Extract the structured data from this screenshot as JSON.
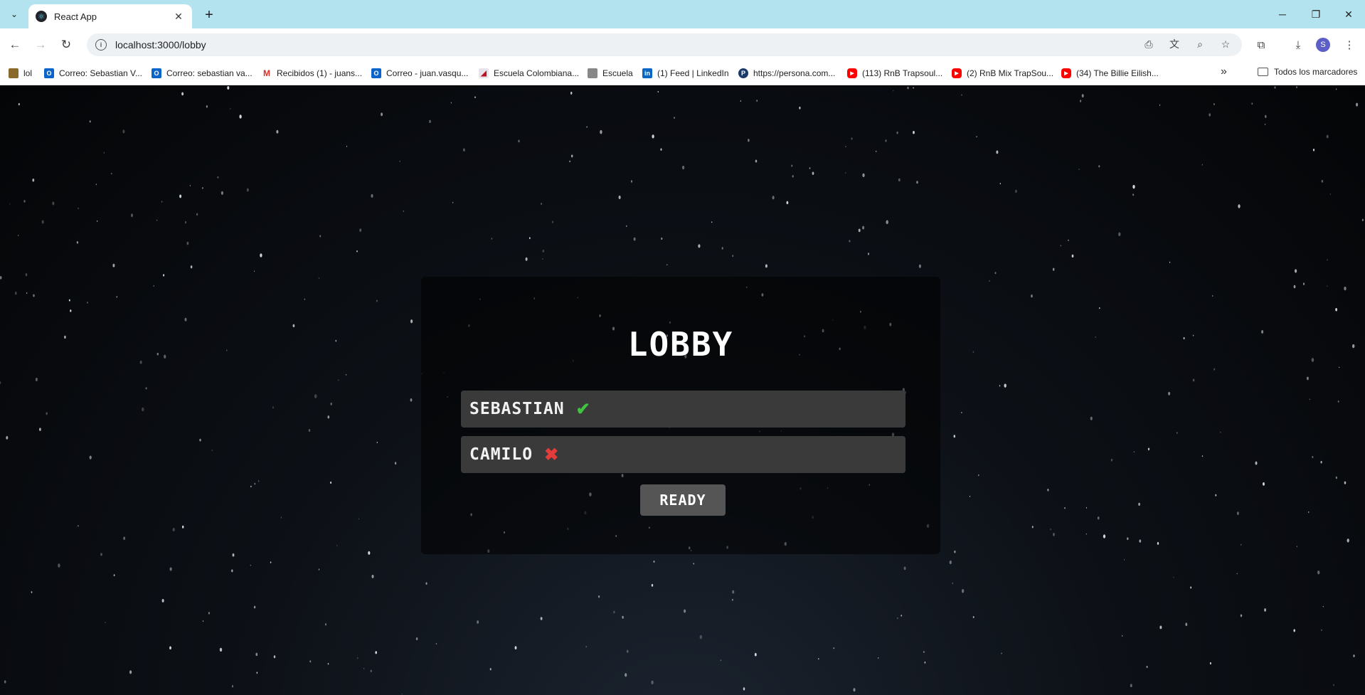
{
  "browser": {
    "tab": {
      "title": "React App",
      "favicon": "react-icon"
    },
    "url": "localhost:3000/lobby",
    "profile_initial": "S",
    "bookmarks": [
      {
        "label": "lol",
        "icon": "lol-icon"
      },
      {
        "label": "Correo: Sebastian V...",
        "icon": "outlook-icon"
      },
      {
        "label": "Correo: sebastian va...",
        "icon": "outlook-icon"
      },
      {
        "label": "Recibidos (1) - juans...",
        "icon": "gmail-icon"
      },
      {
        "label": "Correo - juan.vasqu...",
        "icon": "outlook-icon"
      },
      {
        "label": "Escuela Colombiana...",
        "icon": "escuela-icon"
      },
      {
        "label": "Escuela",
        "icon": "escuela-icon"
      },
      {
        "label": "(1) Feed | LinkedIn",
        "icon": "linkedin-icon"
      },
      {
        "label": "https://persona.com...",
        "icon": "persona-icon"
      },
      {
        "label": "(113) RnB Trapsoul...",
        "icon": "youtube-icon"
      },
      {
        "label": "(2) RnB Mix TrapSou...",
        "icon": "youtube-icon"
      },
      {
        "label": "(34) The Billie Eilish...",
        "icon": "youtube-icon"
      }
    ],
    "all_bookmarks_label": "Todos los marcadores"
  },
  "lobby": {
    "title": "LOBBY",
    "players": [
      {
        "name": "SEBASTIAN",
        "ready": true,
        "status_icon": "check-icon"
      },
      {
        "name": "CAMILO",
        "ready": false,
        "status_icon": "x-icon"
      }
    ],
    "ready_button_label": "READY",
    "colors": {
      "ready": "#3ec43e",
      "not_ready": "#e53b3b",
      "row_bg": "#3a3a3a",
      "button_bg": "#555555"
    }
  }
}
